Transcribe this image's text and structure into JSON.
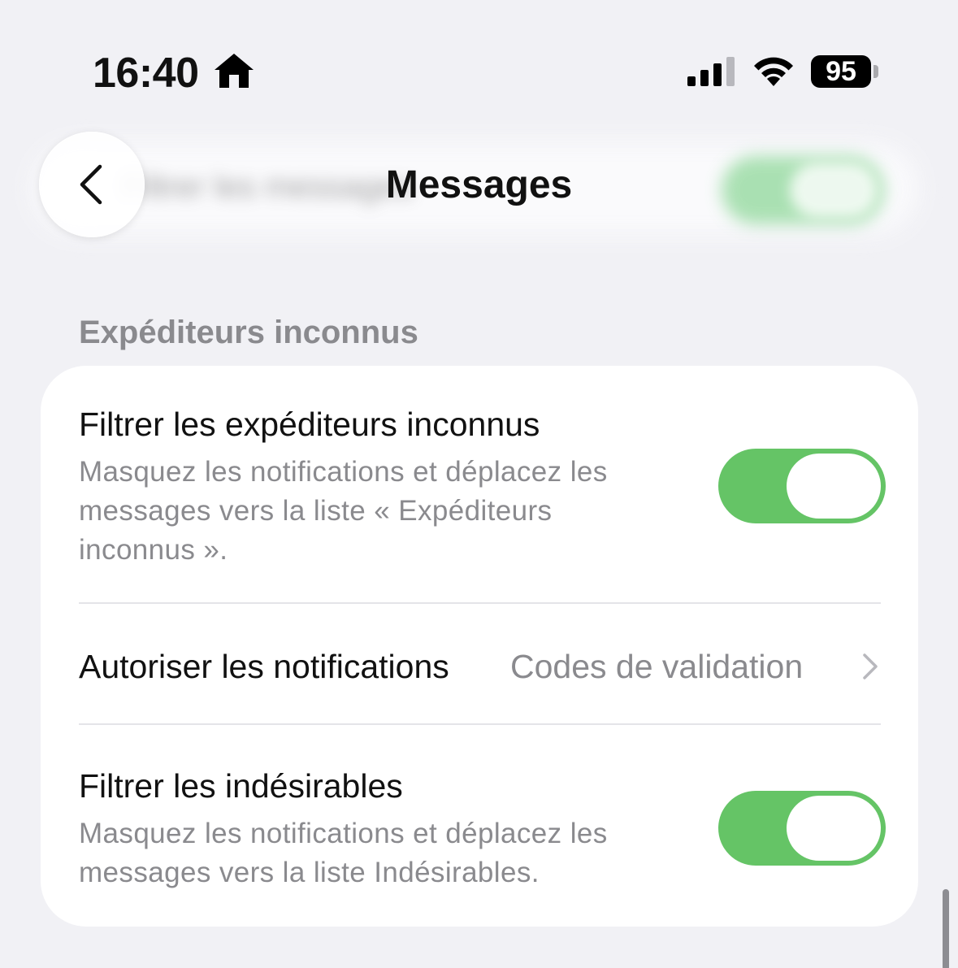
{
  "status_bar": {
    "time": "16:40",
    "battery": "95",
    "icons": [
      "home-icon",
      "signal-icon",
      "wifi-icon",
      "battery-icon"
    ]
  },
  "nav": {
    "title": "Messages",
    "back_icon": "chevron-left-icon"
  },
  "background": {
    "blurred_text": "Filtrer les messages"
  },
  "section": {
    "header": "Expéditeurs inconnus"
  },
  "rows": [
    {
      "title": "Filtrer les expéditeurs inconnus",
      "description": "Masquez les notifications et déplacez les messages vers la liste « Expéditeurs inconnus ».",
      "toggle_on": true
    },
    {
      "title": "Autoriser les notifications",
      "value": "Codes de validation"
    },
    {
      "title": "Filtrer les indésirables",
      "description": "Masquez les notifications et déplacez les messages vers la liste Indésirables.",
      "toggle_on": true
    }
  ],
  "colors": {
    "toggle_on": "#65c466",
    "background": "#f1f1f5",
    "secondary_text": "#8a8a8e"
  }
}
